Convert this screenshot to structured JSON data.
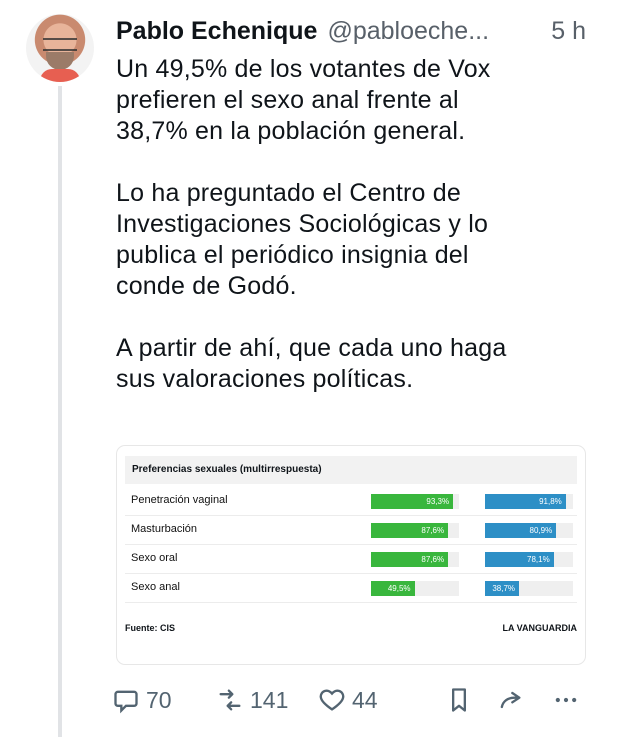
{
  "post": {
    "author_name": "Pablo Echenique",
    "handle": "@pabloeche...",
    "time": "5 h",
    "text": "Un 49,5% de los votantes de Vox\nprefieren el sexo anal frente al\n38,7% en la población general.\n\nLo ha preguntado el Centro de\nInvestigaciones Sociológicas y lo\npublica el periódico insignia del\nconde de Godó.\n\nA partir de ahí, que cada uno haga\nsus valoraciones políticas."
  },
  "card": {
    "footer_left": "Fuente: CIS",
    "footer_right": "LA VANGUARDIA"
  },
  "chart_data": {
    "type": "bar",
    "title": "Preferencias sexuales (multirrespuesta)",
    "categories": [
      "Penetración vaginal",
      "Masturbación",
      "Sexo oral",
      "Sexo anal"
    ],
    "series": [
      {
        "values": [
          93.3,
          87.6,
          87.6,
          49.5
        ],
        "labels": [
          "93,3%",
          "87,6%",
          "87,6%",
          "49,5%"
        ],
        "color": "#39b63d"
      },
      {
        "values": [
          91.8,
          80.9,
          78.1,
          38.7
        ],
        "labels": [
          "91,8%",
          "80,9%",
          "78,1%",
          "38,7%"
        ],
        "color": "#2d8fc6"
      }
    ],
    "ylim": [
      0,
      100
    ],
    "grid": false
  },
  "actions": {
    "replies": "70",
    "retweets": "141",
    "likes": "44"
  },
  "icons": [
    "reply-icon",
    "retweet-icon",
    "like-icon",
    "bookmark-icon",
    "share-icon",
    "more-icon"
  ]
}
